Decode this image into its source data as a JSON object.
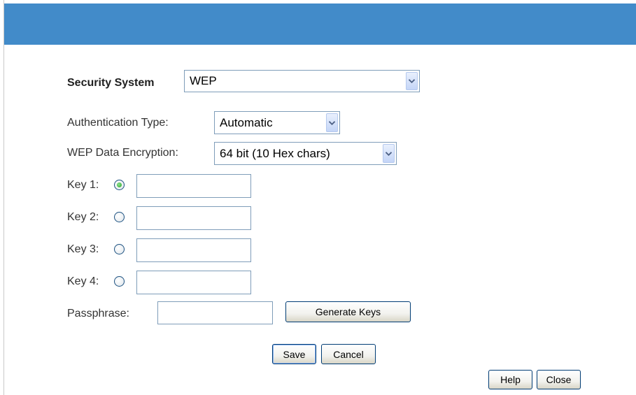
{
  "security": {
    "label": "Security System",
    "value": "WEP"
  },
  "auth": {
    "label": "Authentication Type:",
    "value": "Automatic"
  },
  "encryption": {
    "label": "WEP Data Encryption:",
    "value": "64 bit (10 Hex chars)"
  },
  "keys": [
    {
      "label": "Key 1:",
      "selected": true,
      "value": ""
    },
    {
      "label": "Key 2:",
      "selected": false,
      "value": ""
    },
    {
      "label": "Key 3:",
      "selected": false,
      "value": ""
    },
    {
      "label": "Key 4:",
      "selected": false,
      "value": ""
    }
  ],
  "passphrase": {
    "label": "Passphrase:",
    "value": ""
  },
  "buttons": {
    "generate": "Generate Keys",
    "save": "Save",
    "cancel": "Cancel",
    "help": "Help",
    "close": "Close"
  },
  "colors": {
    "header": "#428bc9"
  }
}
